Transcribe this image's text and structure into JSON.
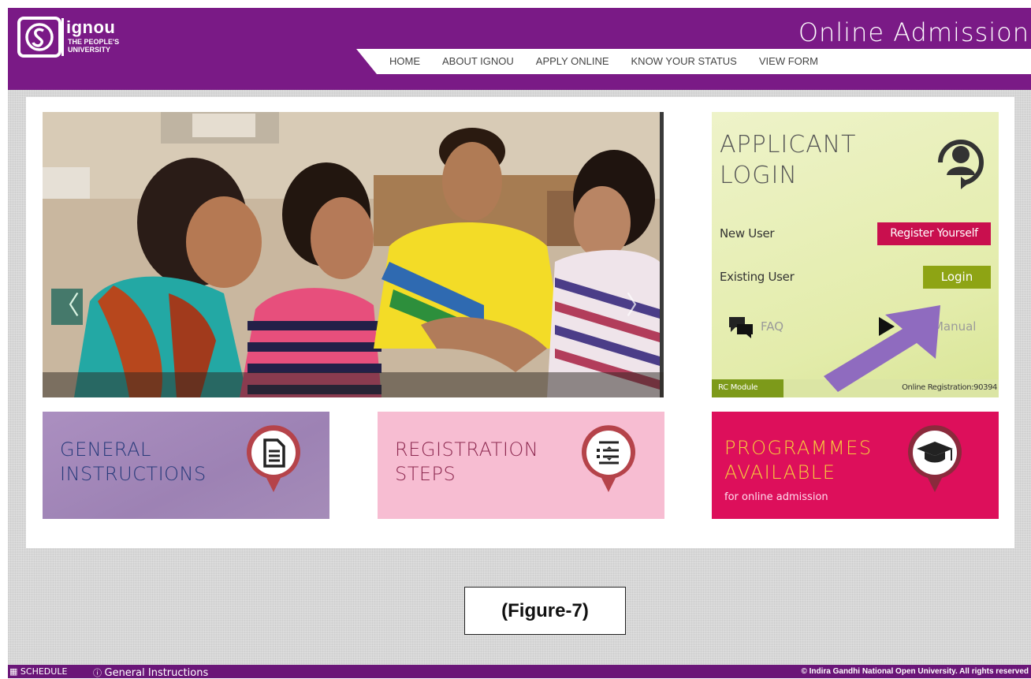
{
  "header": {
    "logo_main": "ignou",
    "logo_sub_1": "THE PEOPLE'S",
    "logo_sub_2": "UNIVERSITY",
    "site_title": "Online Admission",
    "nav": [
      "HOME",
      "ABOUT IGNOU",
      "APPLY ONLINE",
      "KNOW YOUR STATUS",
      "VIEW FORM"
    ]
  },
  "slider": {
    "prev_glyph": "〈",
    "next_glyph": "〉"
  },
  "login": {
    "title_line1": "APPLICANT",
    "title_line2": "LOGIN",
    "new_user_label": "New User",
    "register_button": "Register Yourself",
    "existing_user_label": "Existing User",
    "login_button": "Login",
    "faq_label": "FAQ",
    "manual_label": "User Manual",
    "rc_module": "RC Module",
    "registration_count": "Online Registration:90394"
  },
  "tiles": {
    "general_line1": "GENERAL",
    "general_line2": "INSTRUCTIONS",
    "steps_line1": "REGISTRATION",
    "steps_line2": "STEPS",
    "programmes_line1": "PROGRAMMES",
    "programmes_line2": "AVAILABLE",
    "programmes_sub": "for online admission"
  },
  "caption": "(Figure-7)",
  "footer": {
    "schedule": "SCHEDULE",
    "general_instructions": "General Instructions",
    "copyright": "© Indira Gandhi National Open University. All rights reserved"
  },
  "colors": {
    "brand_purple": "#7a1a86",
    "register_red": "#c90f4e",
    "login_green": "#8ea414",
    "arrow_purple": "#8f6bbf"
  }
}
